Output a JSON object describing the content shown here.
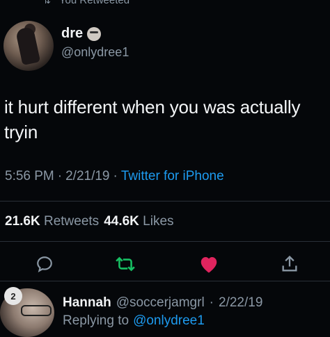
{
  "retweet_banner": {
    "text": "You Retweeted",
    "icon": "retweet-icon"
  },
  "author": {
    "display_name": "dre",
    "name_emoji": "emoji-icon",
    "handle": "@onlydree1"
  },
  "tweet": {
    "text": "it hurt different when you was actually tryin",
    "time": "5:56 PM",
    "date": "2/21/19",
    "separator": "·",
    "source": "Twitter for iPhone"
  },
  "stats": {
    "retweets_count": "21.6K",
    "retweets_label": "Retweets",
    "likes_count": "44.6K",
    "likes_label": "Likes"
  },
  "actions": {
    "reply_icon": "reply-icon",
    "retweet_icon": "retweet-icon",
    "like_icon": "heart-icon",
    "share_icon": "share-icon",
    "retweet_color": "#17bf63",
    "like_color": "#e0245e"
  },
  "reply": {
    "badge": "2",
    "name": "Hannah",
    "handle": "@soccerjamgrl",
    "separator": "·",
    "date": "2/22/19",
    "replying_label": "Replying to",
    "replying_to": "@onlydree1"
  }
}
